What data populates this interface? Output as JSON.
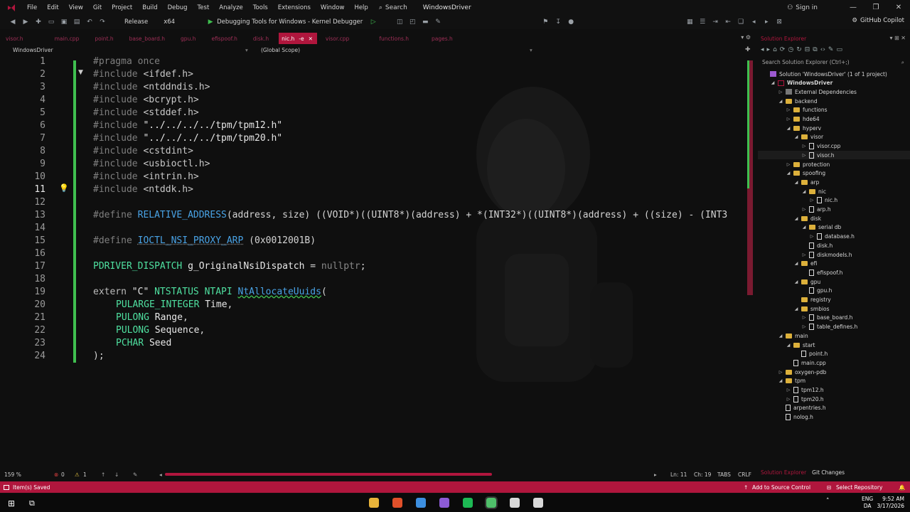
{
  "menubar": {
    "items": [
      "File",
      "Edit",
      "View",
      "Git",
      "Project",
      "Build",
      "Debug",
      "Test",
      "Analyze",
      "Tools",
      "Extensions",
      "Window",
      "Help"
    ],
    "search_label": "Search",
    "solution_name": "WindowsDriver",
    "sign_in": "Sign in"
  },
  "toolbar": {
    "configuration": "Release",
    "platform": "x64",
    "debugger": "Debugging Tools for Windows - Kernel Debugger",
    "copilot": "GitHub Copilot"
  },
  "tabs": [
    {
      "label": "visor.h",
      "active": false
    },
    {
      "label": "main.cpp",
      "active": false
    },
    {
      "label": "point.h",
      "active": false
    },
    {
      "label": "base_board.h",
      "active": false
    },
    {
      "label": "gpu.h",
      "active": false
    },
    {
      "label": "efispoof.h",
      "active": false
    },
    {
      "label": "disk.h",
      "active": false
    },
    {
      "label": "nic.h",
      "active": true
    },
    {
      "label": "visor.cpp",
      "active": false
    },
    {
      "label": "functions.h",
      "active": false
    },
    {
      "label": "pages.h",
      "active": false
    }
  ],
  "navbar": {
    "project": "WindowsDriver",
    "scope": "(Global Scope)"
  },
  "code": {
    "l1": "#pragma once",
    "l2": "ifdef.h",
    "l3": "ntddndis.h",
    "l4": "bcrypt.h",
    "l5": "stddef.h",
    "l6": "\"../../../../tpm/tpm12.h\"",
    "l7": "\"../../../../tpm/tpm20.h\"",
    "l8": "cstdint",
    "l9": "usbioctl.h",
    "l10": "intrin.h",
    "l11": "ntddk.h",
    "include_kw": "#include",
    "define_kw": "#define",
    "macro1_name": "RELATIVE_ADDRESS",
    "macro1_body": "(address, size) ((VOID*)((UINT8*)(address) + *(INT32*)((UINT8*)(address) + ((size) - (INT3",
    "macro2_name": "IOCTL_NSI_PROXY_ARP",
    "macro2_body": " (0x0012001B)",
    "l17_type": "PDRIVER_DISPATCH",
    "l17_var": "g_OriginalNsiDispatch",
    "l17_eq": " = ",
    "l17_val": "nullptr",
    "l17_end": ";",
    "l19_extern": "extern ",
    "l19_c": "\"C\"",
    "l19_ret": "NTSTATUS",
    "l19_api": "NTAPI",
    "l19_fn": "NtAllocateUuids",
    "l19_paren": "(",
    "l20_type": "PULARGE_INTEGER",
    "l20_name": "Time",
    "l21_type": "PULONG",
    "l21_name": "Range",
    "l22_type": "PULONG",
    "l22_name": "Sequence",
    "l23_type": "PCHAR",
    "l23_name": "Seed",
    "l24": ");",
    "line_numbers": [
      "1",
      "2",
      "3",
      "4",
      "5",
      "6",
      "7",
      "8",
      "9",
      "10",
      "11",
      "12",
      "13",
      "14",
      "15",
      "16",
      "17",
      "18",
      "19",
      "20",
      "21",
      "22",
      "23",
      "24"
    ],
    "current_line": 11
  },
  "editor_status": {
    "zoom": "159 %",
    "errors": "0",
    "warnings": "1",
    "line": "Ln: 11",
    "col": "Ch: 19",
    "indent": "TABS",
    "eol": "CRLF"
  },
  "solution_explorer": {
    "title": "Solution Explorer",
    "search_placeholder": "Search Solution Explorer (Ctrl+;)",
    "tabs": [
      "Solution Explorer",
      "Git Changes"
    ],
    "tree": [
      {
        "label": "Solution 'WindowsDriver' (1 of 1 project)",
        "kind": "solution",
        "depth": 0,
        "arrow": ""
      },
      {
        "label": "WindowsDriver",
        "kind": "project",
        "depth": 1,
        "arrow": "▲"
      },
      {
        "label": "External Dependencies",
        "kind": "extdep",
        "depth": 2,
        "arrow": "▶"
      },
      {
        "label": "backend",
        "kind": "folder",
        "depth": 2,
        "arrow": "▲"
      },
      {
        "label": "functions",
        "kind": "folder",
        "depth": 3,
        "arrow": "▶"
      },
      {
        "label": "hde64",
        "kind": "folder",
        "depth": 3,
        "arrow": "▶"
      },
      {
        "label": "hyperv",
        "kind": "folder",
        "depth": 3,
        "arrow": "▲"
      },
      {
        "label": "visor",
        "kind": "folder",
        "depth": 4,
        "arrow": "▲"
      },
      {
        "label": "visor.cpp",
        "kind": "file",
        "depth": 5,
        "arrow": "▶"
      },
      {
        "label": "visor.h",
        "kind": "file",
        "depth": 5,
        "arrow": "▶",
        "selected": true
      },
      {
        "label": "protection",
        "kind": "folder",
        "depth": 3,
        "arrow": "▶"
      },
      {
        "label": "spoofing",
        "kind": "folder",
        "depth": 3,
        "arrow": "▲"
      },
      {
        "label": "arp",
        "kind": "folder",
        "depth": 4,
        "arrow": "▲"
      },
      {
        "label": "nic",
        "kind": "folder",
        "depth": 5,
        "arrow": "▲"
      },
      {
        "label": "nic.h",
        "kind": "file",
        "depth": 6,
        "arrow": "▶"
      },
      {
        "label": "arp.h",
        "kind": "file",
        "depth": 5,
        "arrow": "▶"
      },
      {
        "label": "disk",
        "kind": "folder",
        "depth": 4,
        "arrow": "▲"
      },
      {
        "label": "serial db",
        "kind": "folder",
        "depth": 5,
        "arrow": "▲"
      },
      {
        "label": "database.h",
        "kind": "file",
        "depth": 6,
        "arrow": "▶"
      },
      {
        "label": "disk.h",
        "kind": "file",
        "depth": 5,
        "arrow": ""
      },
      {
        "label": "diskmodels.h",
        "kind": "file",
        "depth": 5,
        "arrow": "▶"
      },
      {
        "label": "efi",
        "kind": "folder",
        "depth": 4,
        "arrow": "▲"
      },
      {
        "label": "efispoof.h",
        "kind": "file",
        "depth": 5,
        "arrow": ""
      },
      {
        "label": "gpu",
        "kind": "folder",
        "depth": 4,
        "arrow": "▲"
      },
      {
        "label": "gpu.h",
        "kind": "file",
        "depth": 5,
        "arrow": ""
      },
      {
        "label": "registry",
        "kind": "folder",
        "depth": 4,
        "arrow": ""
      },
      {
        "label": "smbios",
        "kind": "folder",
        "depth": 4,
        "arrow": "▲"
      },
      {
        "label": "base_board.h",
        "kind": "file",
        "depth": 5,
        "arrow": "▶"
      },
      {
        "label": "table_defines.h",
        "kind": "file",
        "depth": 5,
        "arrow": "▶"
      },
      {
        "label": "main",
        "kind": "folder",
        "depth": 2,
        "arrow": "▲"
      },
      {
        "label": "start",
        "kind": "folder",
        "depth": 3,
        "arrow": "▲"
      },
      {
        "label": "point.h",
        "kind": "file",
        "depth": 4,
        "arrow": ""
      },
      {
        "label": "main.cpp",
        "kind": "file",
        "depth": 3,
        "arrow": ""
      },
      {
        "label": "oxygen-pdb",
        "kind": "folder",
        "depth": 2,
        "arrow": "▶"
      },
      {
        "label": "tpm",
        "kind": "folder",
        "depth": 2,
        "arrow": "▲"
      },
      {
        "label": "tpm12.h",
        "kind": "file",
        "depth": 3,
        "arrow": "▶"
      },
      {
        "label": "tpm20.h",
        "kind": "file",
        "depth": 3,
        "arrow": "▶"
      },
      {
        "label": "arpentries.h",
        "kind": "file",
        "depth": 2,
        "arrow": ""
      },
      {
        "label": "nolog.h",
        "kind": "file",
        "depth": 2,
        "arrow": ""
      }
    ]
  },
  "statusbar": {
    "saved": "Item(s) Saved",
    "add_source": "Add to Source Control",
    "select_repo": "Select Repository"
  },
  "taskbar": {
    "lang_top": "ENG",
    "lang_bottom": "DA",
    "time": "9:52 AM",
    "date": "3/17/2026",
    "apps": [
      {
        "name": "file-explorer",
        "color": "#e8b43a"
      },
      {
        "name": "brave",
        "color": "#e0502a"
      },
      {
        "name": "chrome",
        "color": "#3d8fe0"
      },
      {
        "name": "visual-studio",
        "color": "#8d5bd6"
      },
      {
        "name": "spotify",
        "color": "#1db954"
      },
      {
        "name": "notepad",
        "color": "#4fbf6a"
      },
      {
        "name": "app-7",
        "color": "#d9d9d9"
      },
      {
        "name": "app-8",
        "color": "#d9d9d9"
      }
    ]
  },
  "colors": {
    "accent": "#b0163d",
    "change_bar": "#3fbf4f",
    "type": "#4fe0a0",
    "macro": "#49a3e6"
  }
}
